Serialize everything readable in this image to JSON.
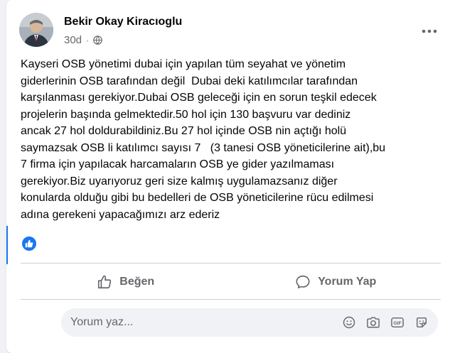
{
  "post": {
    "author": "Bekir Okay Kiracıoglu",
    "time": "30d",
    "text_lines": [
      "Kayseri OSB yönetimi dubai için yapılan tüm seyahat ve yönetim",
      "giderlerinin OSB tarafından değil  Dubai deki katılımcılar tarafından",
      "karşılanması gerekiyor.Dubai OSB geleceği için en sorun teşkil edecek",
      "projelerin başında gelmektedir.50 hol için 130 başvuru var dediniz",
      "ancak 27 hol doldurabildiniz.Bu 27 hol içinde OSB nin açtığı holü",
      "saymazsak OSB li katılımcı sayısı 7   (3 tanesi OSB yöneticilerine ait),bu",
      "7 firma için yapılacak harcamaların OSB ye gider yazılmaması",
      "gerekiyor.Biz uyarıyoruz geri size kalmış uygulamazsanız diğer",
      "konularda olduğu gibi bu bedelleri de OSB yöneticilerine rücu edilmesi",
      "adına gerekeni yapacağımızı arz ederiz"
    ]
  },
  "actions": {
    "like_label": "Beğen",
    "comment_label": "Yorum Yap"
  },
  "comment": {
    "placeholder": "Yorum yaz..."
  },
  "icons": {
    "more": "more-horizontal-icon",
    "audience": "globe-icon",
    "like": "thumbs-up-icon",
    "comment": "speech-bubble-icon",
    "emoji": "emoji-icon",
    "camera": "camera-icon",
    "gif": "gif-icon",
    "sticker": "sticker-icon"
  },
  "colors": {
    "accent": "#1877f2",
    "secondary_text": "#65676b",
    "comment_bg": "#f0f2f5"
  }
}
